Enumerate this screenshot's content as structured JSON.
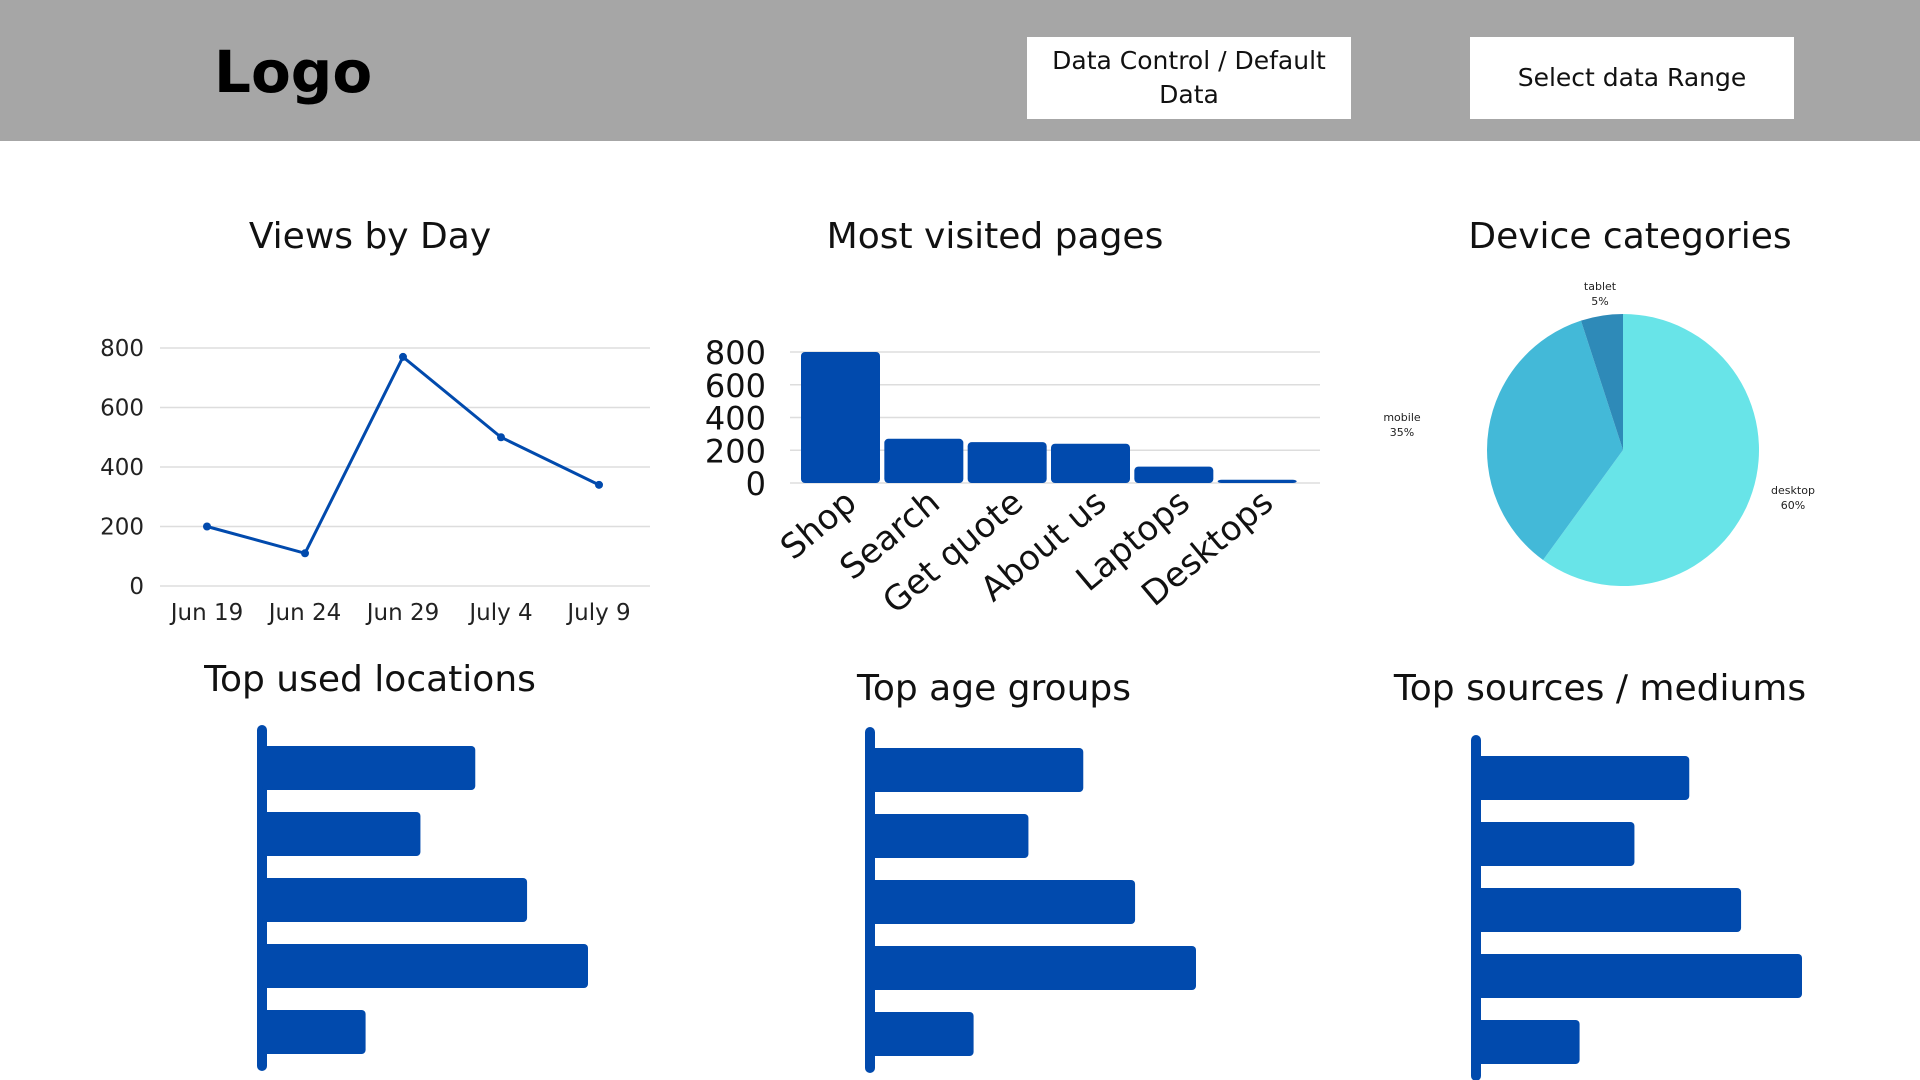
{
  "header": {
    "logo": "Logo",
    "data_control_button": "Data Control / Default Data",
    "date_range_button": "Select data Range",
    "background": "#a6a6a6"
  },
  "colors": {
    "primary_blue": "#014aad",
    "grid": "#dddddd",
    "pie_desktop": "#68e4e8",
    "pie_mobile": "#43b9d8",
    "pie_tablet": "#2e8ab8"
  },
  "panels": {
    "views_by_day": {
      "title": "Views by Day"
    },
    "most_visited_pages": {
      "title": "Most visited pages"
    },
    "device_categories": {
      "title": "Device categories"
    },
    "top_used_locations": {
      "title": "Top used locations"
    },
    "top_age_groups": {
      "title": "Top age groups"
    },
    "top_sources_mediums": {
      "title": "Top sources / mediums"
    }
  },
  "chart_data": [
    {
      "id": "views_by_day",
      "type": "line",
      "title": "Views by Day",
      "x": [
        "Jun 19",
        "Jun 24",
        "Jun 29",
        "July 4",
        "July 9"
      ],
      "values": [
        200,
        110,
        770,
        500,
        340
      ],
      "ylim": [
        0,
        800
      ],
      "yticks": [
        "0",
        "200",
        "400",
        "600",
        "800"
      ],
      "grid": true
    },
    {
      "id": "most_visited_pages",
      "type": "bar",
      "title": "Most visited pages",
      "categories": [
        "Shop",
        "Search",
        "Get quote",
        "About us",
        "Laptops",
        "Desktops"
      ],
      "values": [
        800,
        270,
        250,
        240,
        100,
        20
      ],
      "ylim": [
        0,
        800
      ],
      "yticks": [
        "0",
        "200",
        "400",
        "600",
        "800"
      ],
      "grid": true
    },
    {
      "id": "device_categories",
      "type": "pie",
      "title": "Device categories",
      "slices": [
        {
          "name": "desktop",
          "pct_label": "60%",
          "value": 60
        },
        {
          "name": "mobile",
          "pct_label": "35%",
          "value": 35
        },
        {
          "name": "tablet",
          "pct_label": "5%",
          "value": 5
        }
      ]
    },
    {
      "id": "top_used_locations",
      "type": "bar",
      "orientation": "horizontal",
      "title": "Top used locations",
      "values": [
        70,
        52,
        87,
        107,
        34
      ]
    },
    {
      "id": "top_age_groups",
      "type": "bar",
      "orientation": "horizontal",
      "title": "Top age groups",
      "values": [
        70,
        52,
        87,
        107,
        34
      ]
    },
    {
      "id": "top_sources_mediums",
      "type": "bar",
      "orientation": "horizontal",
      "title": "Top sources / mediums",
      "values": [
        70,
        52,
        87,
        107,
        34
      ]
    }
  ]
}
